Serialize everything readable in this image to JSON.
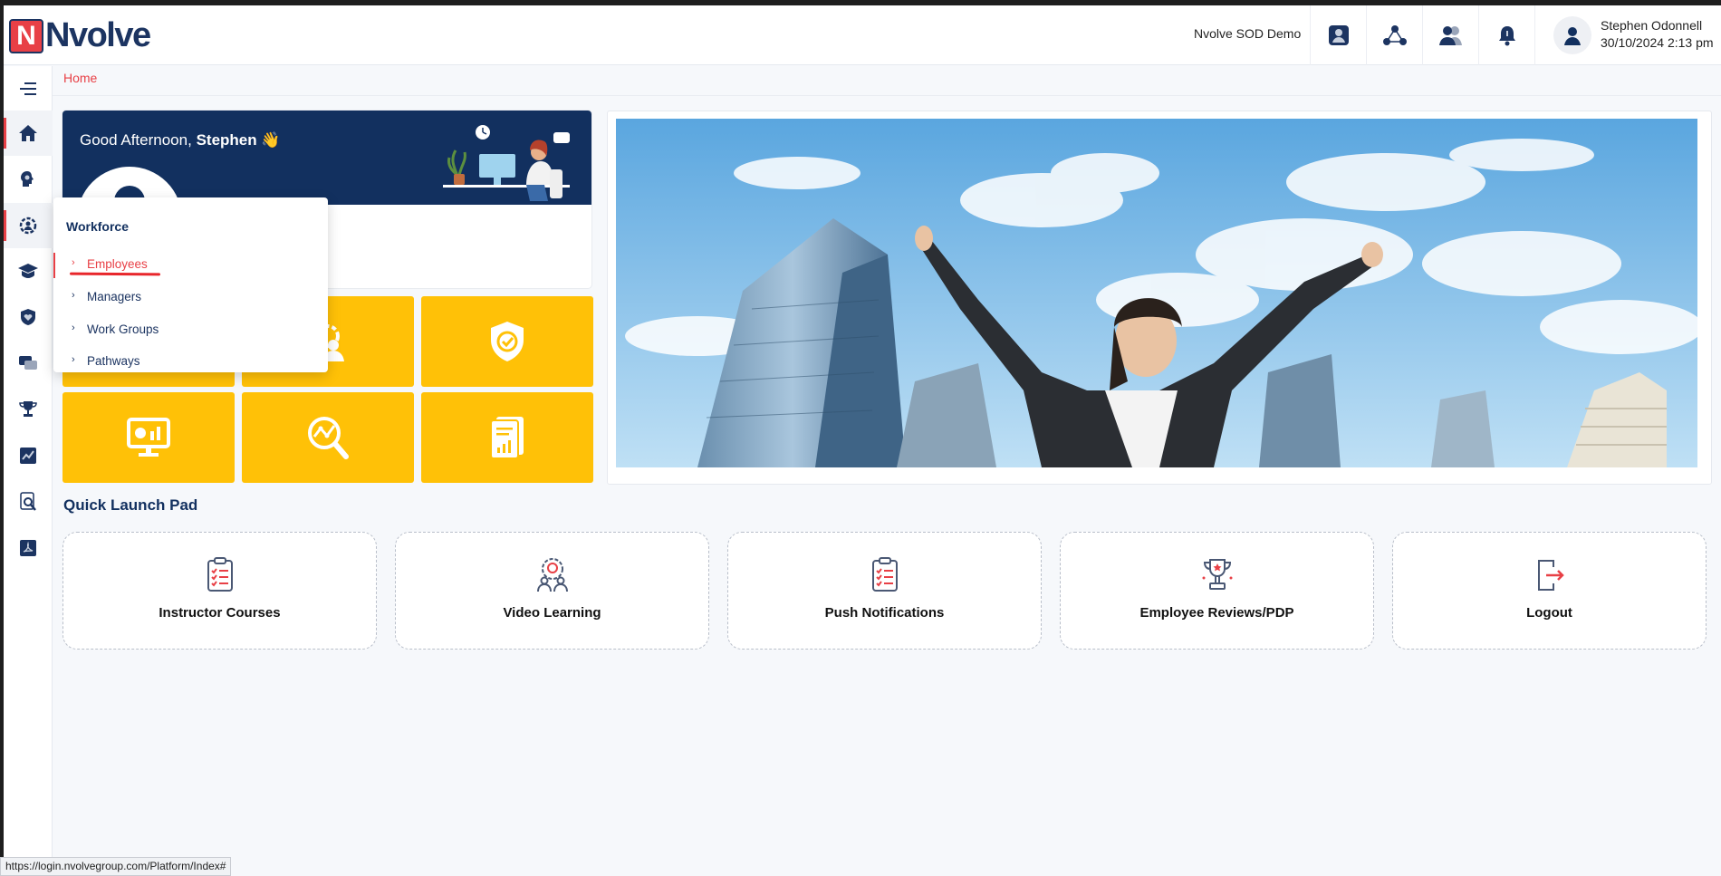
{
  "header": {
    "logo_letter": "N",
    "logo_text": "Nvolve",
    "org_name": "Nvolve SOD Demo",
    "user_name": "Stephen Odonnell",
    "datetime": "30/10/2024 2:13 pm"
  },
  "breadcrumb": "Home",
  "greeting": {
    "prefix": "Good Afternoon,",
    "name": "Stephen",
    "emoji": "👋"
  },
  "dropdown": {
    "title": "Workforce",
    "items": [
      {
        "label": "Employees",
        "active": true
      },
      {
        "label": "Managers"
      },
      {
        "label": "Work Groups"
      },
      {
        "label": "Pathways"
      }
    ]
  },
  "quick_launch": {
    "title": "Quick Launch Pad",
    "cards": [
      {
        "label": "Instructor Courses",
        "icon": "clipboard-checklist-icon"
      },
      {
        "label": "Video Learning",
        "icon": "video-learning-icon"
      },
      {
        "label": "Push Notifications",
        "icon": "clipboard-checklist-icon"
      },
      {
        "label": "Employee Reviews/PDP",
        "icon": "trophy-icon"
      },
      {
        "label": "Logout",
        "icon": "logout-icon"
      }
    ]
  },
  "status_url": "https://login.nvolvegroup.com/Platform/Index#",
  "colors": {
    "brand_navy": "#12305f",
    "brand_red": "#e84046",
    "tile_yellow": "#ffc107"
  }
}
